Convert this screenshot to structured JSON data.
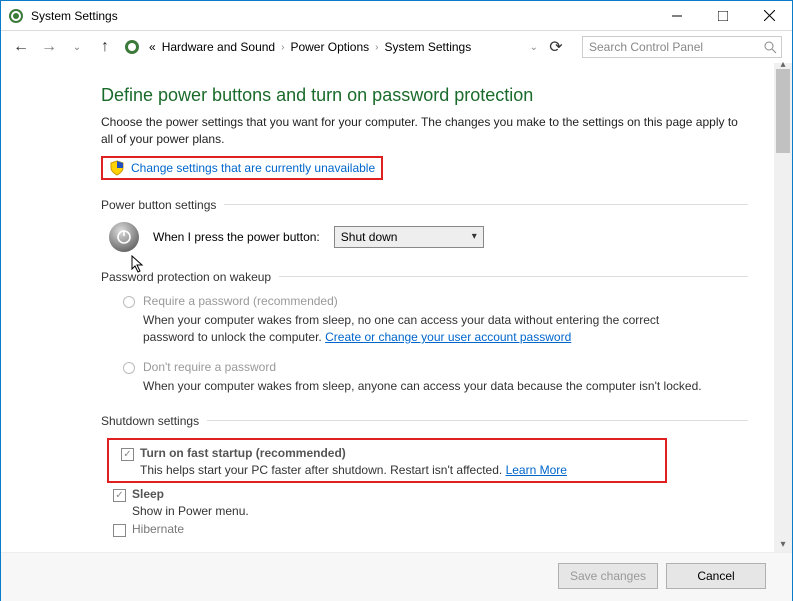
{
  "window": {
    "title": "System Settings"
  },
  "breadcrumbs": {
    "prefix": "«",
    "level1": "Hardware and Sound",
    "level2": "Power Options",
    "level3": "System Settings"
  },
  "search": {
    "placeholder": "Search Control Panel"
  },
  "heading": "Define power buttons and turn on password protection",
  "intro": "Choose the power settings that you want for your computer. The changes you make to the settings on this page apply to all of your power plans.",
  "admin_link": "Change settings that are currently unavailable",
  "sections": {
    "power_button": {
      "label": "Power button settings",
      "row_label": "When I press the power button:",
      "value": "Shut down"
    },
    "password": {
      "label": "Password protection on wakeup",
      "opt1_label": "Require a password (recommended)",
      "opt1_desc_a": "When your computer wakes from sleep, no one can access your data without entering the correct password to unlock the computer. ",
      "opt1_link": "Create or change your user account password",
      "opt2_label": "Don't require a password",
      "opt2_desc": "When your computer wakes from sleep, anyone can access your data because the computer isn't locked."
    },
    "shutdown": {
      "label": "Shutdown settings",
      "fast_label": "Turn on fast startup (recommended)",
      "fast_desc": "This helps start your PC faster after shutdown. Restart isn't affected. ",
      "fast_link": "Learn More",
      "sleep_label": "Sleep",
      "sleep_desc": "Show in Power menu.",
      "hibernate_label": "Hibernate"
    }
  },
  "buttons": {
    "save": "Save changes",
    "cancel": "Cancel"
  }
}
